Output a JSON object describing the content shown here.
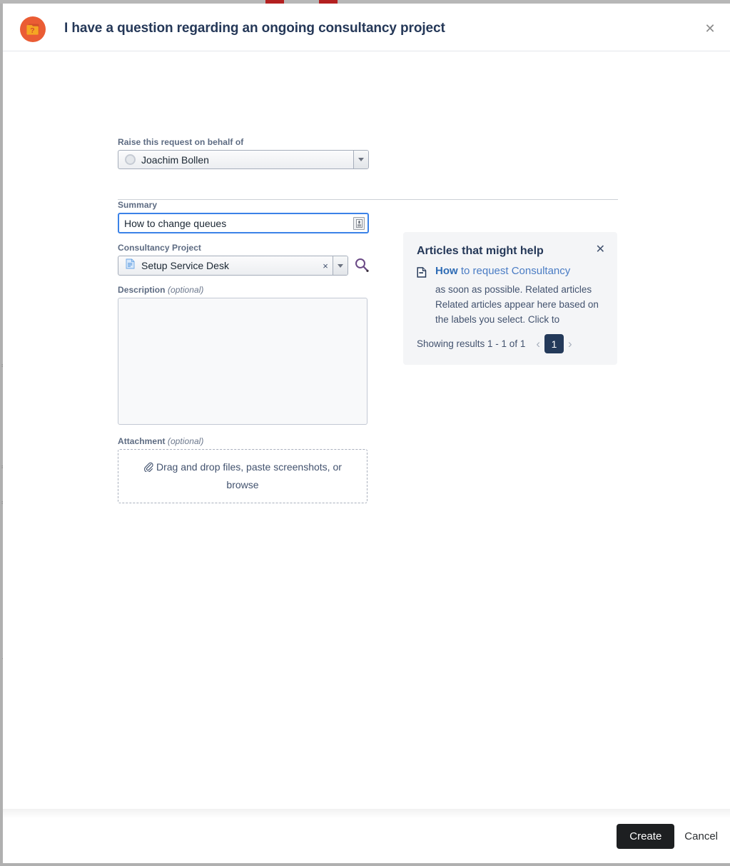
{
  "window": {
    "title": "I have a question regarding an ongoing consultancy project",
    "request_type_icon": "folder-question-icon",
    "close_label": "✕",
    "accent_icon_bg": "#ea5c34",
    "title_color": "#253858"
  },
  "form": {
    "behalf_of": {
      "label": "Raise this request on behalf of",
      "value": "Joachim Bollen",
      "avatar_icon": "user-avatar-placeholder-icon",
      "dropdown_icon": "chevron-down-icon"
    },
    "summary": {
      "label": "Summary",
      "value": "How to change queues",
      "placeholder": "",
      "affix_icon": "text-field-icon",
      "focus_color": "#3b82e8"
    },
    "consultancy_project": {
      "label": "Consultancy Project",
      "value": "Setup Service Desk",
      "item_icon": "document-blue-icon",
      "clear_label": "×",
      "clear_icon": "clear-x-icon",
      "dropdown_icon": "chevron-down-icon",
      "search_icon": "magnifier-icon",
      "search_icon_color": "#6b4a86"
    },
    "description": {
      "label": "Description",
      "optional_label": "(optional)",
      "value": "",
      "placeholder": ""
    },
    "attachment": {
      "label": "Attachment",
      "optional_label": "(optional)",
      "dropzone_text": "Drag and drop files, paste screenshots, or browse",
      "paperclip_icon": "paperclip-icon"
    }
  },
  "help_panel": {
    "heading": "Articles that might help",
    "close_label": "✕",
    "close_icon": "close-icon",
    "background": "#f4f5f7",
    "article": {
      "doc_icon": "article-document-icon",
      "title_bold": "How",
      "title_rest": " to request Consultancy",
      "snippet": "as soon as possible. Related articles Related articles appear here based on the labels you select. Click to"
    },
    "results_text": "Showing results 1 - 1 of 1",
    "pagination": {
      "prev_label": "‹",
      "prev_icon": "chevron-left-icon",
      "current_page": "1",
      "next_label": "›",
      "next_icon": "chevron-right-icon",
      "active_bg": "#243a5a"
    }
  },
  "footer": {
    "create_label": "Create",
    "cancel_label": "Cancel",
    "create_bg": "#1d1f21"
  },
  "background_bleed": {
    "ghost_lines": [
      "≡",
      "❘",
      "≡",
      "≡",
      "❙",
      "·",
      "❙",
      "❙"
    ]
  }
}
